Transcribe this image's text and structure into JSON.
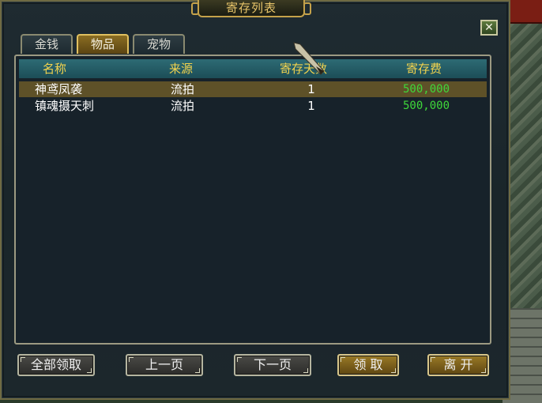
{
  "window": {
    "title": "寄存列表",
    "close_icon": "close-x-icon"
  },
  "tabs": [
    {
      "label": "金钱",
      "active": false
    },
    {
      "label": "物品",
      "active": true
    },
    {
      "label": "宠物",
      "active": false
    }
  ],
  "table": {
    "columns": [
      "名称",
      "来源",
      "寄存天数",
      "寄存费"
    ],
    "rows": [
      {
        "name": "神鸢凤袭",
        "source": "流拍",
        "days": "1",
        "fee": "500,000",
        "selected": true
      },
      {
        "name": "镇魂摄天刺",
        "source": "流拍",
        "days": "1",
        "fee": "500,000",
        "selected": false
      }
    ]
  },
  "buttons": {
    "claim_all": "全部领取",
    "prev_page": "上一页",
    "next_page": "下一页",
    "claim": "领 取",
    "leave": "离 开"
  },
  "colors": {
    "header_text": "#f2d34e",
    "fee_text": "#3fd83a",
    "selected_row": "#5e5128",
    "active_tab": "#8a6d22"
  }
}
